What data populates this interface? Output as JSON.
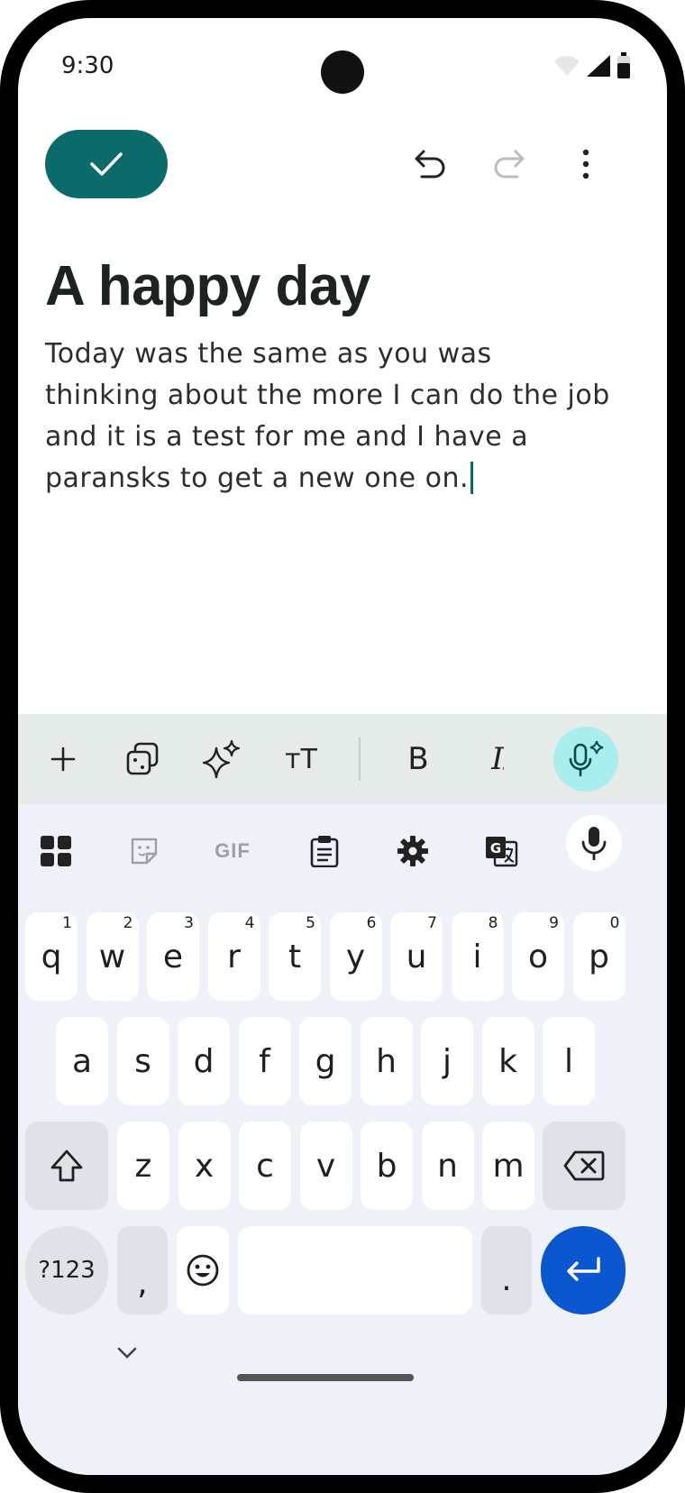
{
  "status": {
    "time": "9:30"
  },
  "note": {
    "title": "A happy day",
    "body": "Today was the same as you was thinking about the more I can do the job and it is a test for me and I have a paransks to get a new one on."
  },
  "toolbar": {
    "icons": [
      "check-icon",
      "undo-icon",
      "redo-icon",
      "more-vert-icon"
    ]
  },
  "format_bar": {
    "bold_label": "B",
    "italic_label": "I",
    "text_size_label": "тT"
  },
  "keyboard": {
    "strip": {
      "gif_label": "GIF"
    },
    "row1": [
      {
        "k": "q",
        "h": "1"
      },
      {
        "k": "w",
        "h": "2"
      },
      {
        "k": "e",
        "h": "3"
      },
      {
        "k": "r",
        "h": "4"
      },
      {
        "k": "t",
        "h": "5"
      },
      {
        "k": "y",
        "h": "6"
      },
      {
        "k": "u",
        "h": "7"
      },
      {
        "k": "i",
        "h": "8"
      },
      {
        "k": "o",
        "h": "9"
      },
      {
        "k": "p",
        "h": "0"
      }
    ],
    "row2": [
      "a",
      "s",
      "d",
      "f",
      "g",
      "h",
      "j",
      "k",
      "l"
    ],
    "row3": [
      "z",
      "x",
      "c",
      "v",
      "b",
      "n",
      "m"
    ],
    "symbols_label": "?123",
    "comma_label": ",",
    "period_label": "."
  },
  "colors": {
    "accent": "#0b6a6a",
    "enter_key": "#0b57d0",
    "voice_fab": "#a8eeec"
  }
}
